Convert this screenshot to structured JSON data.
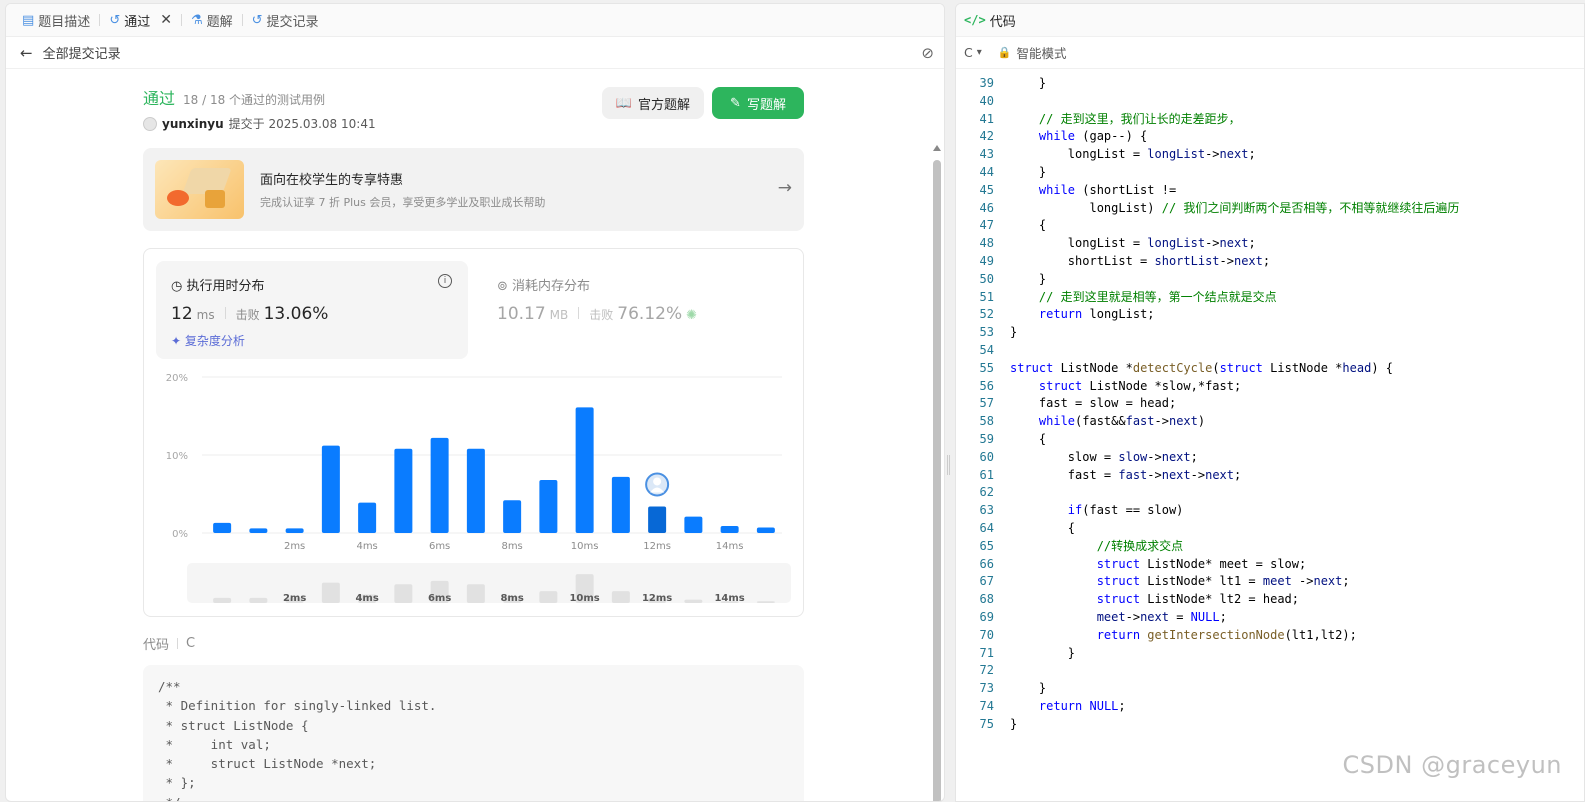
{
  "tabs": [
    {
      "label": "题目描述",
      "icon": "document-icon"
    },
    {
      "label": "通过",
      "icon": "history-icon",
      "active": true
    },
    {
      "label": "题解",
      "icon": "flask-icon"
    },
    {
      "label": "提交记录",
      "icon": "history-icon"
    }
  ],
  "close_symbol": "✕",
  "back_label": "全部提交记录",
  "submission": {
    "status": "通过",
    "cases": "18 / 18 个通过的测试用例",
    "user": "yunxinyu",
    "submitted_at": "提交于 2025.03.08 10:41"
  },
  "buttons": {
    "official": "官方题解",
    "write": "写题解"
  },
  "promo": {
    "title": "面向在校学生的专享特惠",
    "subtitle": "完成认证享 7 折 Plus 会员，享受更多学业及职业成长帮助"
  },
  "runtime": {
    "title": "执行用时分布",
    "value": "12",
    "unit": "ms",
    "beat_label": "击败",
    "beat_pct": "13.06%",
    "complexity": "复杂度分析"
  },
  "memory": {
    "title": "消耗内存分布",
    "value": "10.17",
    "unit": "MB",
    "beat_label": "击败",
    "beat_pct": "76.12%"
  },
  "chart_data": {
    "type": "bar",
    "y_ticks": [
      "20%",
      "10%",
      "0%"
    ],
    "ylim": [
      0,
      20
    ],
    "x_ticks": [
      "2ms",
      "4ms",
      "6ms",
      "8ms",
      "10ms",
      "12ms",
      "14ms"
    ],
    "values": [
      1.3,
      0.6,
      0.6,
      11.2,
      3.9,
      10.8,
      12.2,
      10.8,
      4.2,
      6.8,
      16.1,
      7.2,
      3.4,
      2.1,
      0.9,
      0.7
    ],
    "highlight_index": 12,
    "bar_color": "#0a7cff",
    "highlight_color": "#0768d6",
    "mini_values": [
      0.3,
      0.3,
      0.3,
      1.2,
      0.5,
      1.1,
      1.3,
      1.1,
      0.4,
      0.7,
      1.7,
      0.7,
      0.3,
      0.2,
      0.1,
      0.1
    ]
  },
  "code_section": {
    "label": "代码",
    "lang": "C",
    "snippet": "/**\n * Definition for singly-linked list.\n * struct ListNode {\n *     int val;\n *     struct ListNode *next;\n * };\n */"
  },
  "editor": {
    "header": "代码",
    "lang": "C",
    "mode": "智能模式",
    "lines": [
      {
        "n": "39",
        "html": "    }"
      },
      {
        "n": "40",
        "html": ""
      },
      {
        "n": "41",
        "html": "    <span class=\"cm\">// 走到这里，我们让长的走差距步，</span>"
      },
      {
        "n": "42",
        "html": "    <span class=\"kw\">while</span> (gap--) {"
      },
      {
        "n": "43",
        "html": "        longList = <span class=\"vr\">longList</span>-><span class=\"vr\">next</span>;"
      },
      {
        "n": "44",
        "html": "    }"
      },
      {
        "n": "45",
        "html": "    <span class=\"kw\">while</span> (shortList !="
      },
      {
        "n": "46",
        "html": "           longList) <span class=\"cm\">// 我们之间判断两个是否相等，不相等就继续往后遍历</span>"
      },
      {
        "n": "47",
        "html": "    {"
      },
      {
        "n": "48",
        "html": "        longList = <span class=\"vr\">longList</span>-><span class=\"vr\">next</span>;"
      },
      {
        "n": "49",
        "html": "        shortList = <span class=\"vr\">shortList</span>-><span class=\"vr\">next</span>;"
      },
      {
        "n": "50",
        "html": "    }"
      },
      {
        "n": "51",
        "html": "    <span class=\"cm\">// 走到这里就是相等，第一个结点就是交点</span>"
      },
      {
        "n": "52",
        "html": "    <span class=\"kw\">return</span> longList;"
      },
      {
        "n": "53",
        "html": "}"
      },
      {
        "n": "54",
        "html": ""
      },
      {
        "n": "55",
        "html": "<span class=\"kw\">struct</span> ListNode *<span class=\"fn\">detectCycle</span>(<span class=\"kw\">struct</span> ListNode *<span class=\"vr\">head</span>) {"
      },
      {
        "n": "56",
        "html": "    <span class=\"kw\">struct</span> ListNode *slow,*fast;"
      },
      {
        "n": "57",
        "html": "    fast = slow = head;"
      },
      {
        "n": "58",
        "html": "    <span class=\"kw\">while</span>(fast&&<span class=\"vr\">fast</span>-><span class=\"vr\">next</span>)"
      },
      {
        "n": "59",
        "html": "    {"
      },
      {
        "n": "60",
        "html": "        slow = <span class=\"vr\">slow</span>-><span class=\"vr\">next</span>;"
      },
      {
        "n": "61",
        "html": "        fast = <span class=\"vr\">fast</span>-><span class=\"vr\">next</span>-><span class=\"vr\">next</span>;"
      },
      {
        "n": "62",
        "html": ""
      },
      {
        "n": "63",
        "html": "        <span class=\"kw\">if</span>(fast == slow)"
      },
      {
        "n": "64",
        "html": "        {"
      },
      {
        "n": "65",
        "html": "            <span class=\"cm\">//转换成求交点</span>"
      },
      {
        "n": "66",
        "html": "            <span class=\"kw\">struct</span> ListNode* meet = slow;"
      },
      {
        "n": "67",
        "html": "            <span class=\"kw\">struct</span> ListNode* lt1 = <span class=\"vr\">meet</span> -><span class=\"vr\">next</span>;"
      },
      {
        "n": "68",
        "html": "            <span class=\"kw\">struct</span> ListNode* lt2 = head;"
      },
      {
        "n": "69",
        "html": "            <span class=\"vr\">meet</span>-><span class=\"vr\">next</span> = <span class=\"kw\">NULL</span>;"
      },
      {
        "n": "70",
        "html": "            <span class=\"kw\">return</span> <span class=\"fn\">getIntersectionNode</span>(lt1,lt2);"
      },
      {
        "n": "71",
        "html": "        }"
      },
      {
        "n": "72",
        "html": ""
      },
      {
        "n": "73",
        "html": "    }"
      },
      {
        "n": "74",
        "html": "    <span class=\"kw\">return</span> <span class=\"kw\">NULL</span>;"
      },
      {
        "n": "75",
        "html": "}"
      }
    ]
  },
  "watermark": "CSDN @graceyun"
}
